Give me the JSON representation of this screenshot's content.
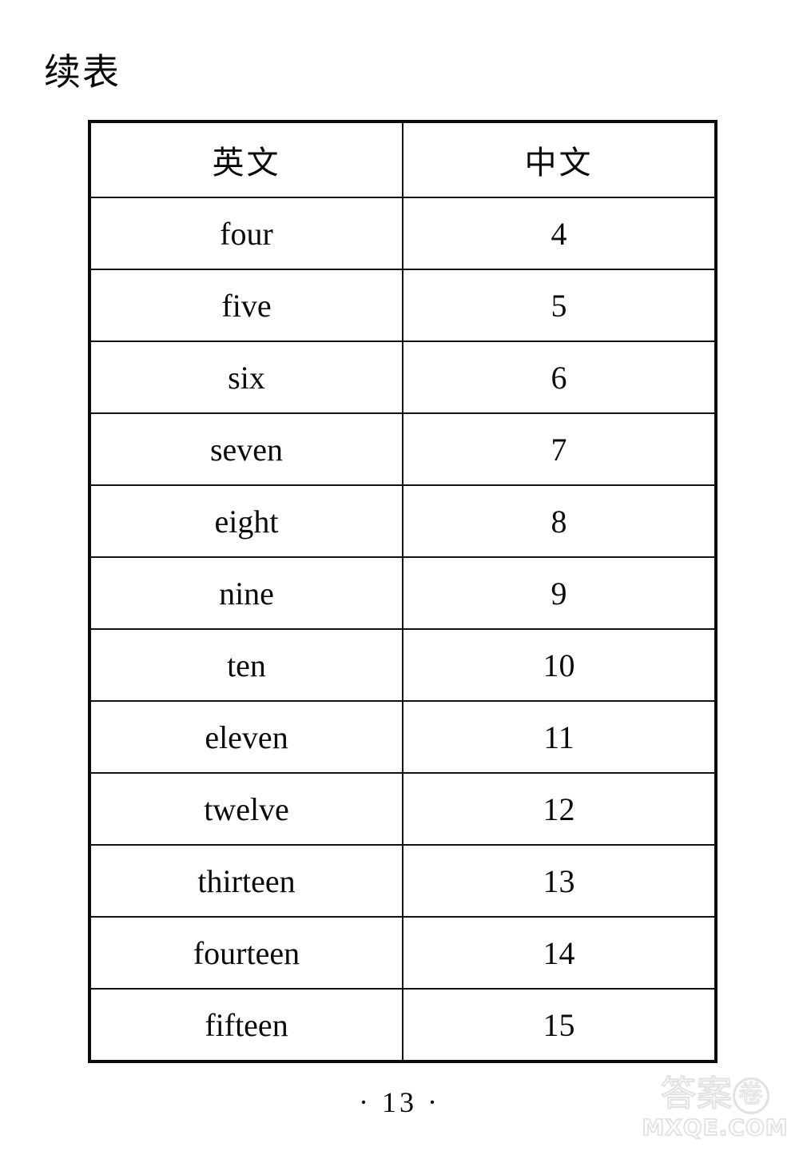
{
  "document": {
    "title": "续表",
    "page_number": "· 13 ·"
  },
  "table": {
    "columns": [
      {
        "key": "english",
        "header": "英文"
      },
      {
        "key": "chinese",
        "header": "中文"
      }
    ],
    "rows": [
      {
        "english": "four",
        "chinese": "4"
      },
      {
        "english": "five",
        "chinese": "5"
      },
      {
        "english": "six",
        "chinese": "6"
      },
      {
        "english": "seven",
        "chinese": "7"
      },
      {
        "english": "eight",
        "chinese": "8"
      },
      {
        "english": "nine",
        "chinese": "9"
      },
      {
        "english": "ten",
        "chinese": "10"
      },
      {
        "english": "eleven",
        "chinese": "11"
      },
      {
        "english": "twelve",
        "chinese": "12"
      },
      {
        "english": "thirteen",
        "chinese": "13"
      },
      {
        "english": "fourteen",
        "chinese": "14"
      },
      {
        "english": "fifteen",
        "chinese": "15"
      }
    ]
  },
  "watermark": {
    "logo_text_1": "答案",
    "logo_text_circled": "卷",
    "url_text": "MXQE.COM",
    "color": "#e2e2e2"
  },
  "colors": {
    "page_background": "#ffffff",
    "ink": "#0b0b0b",
    "table_border": "#111111"
  }
}
